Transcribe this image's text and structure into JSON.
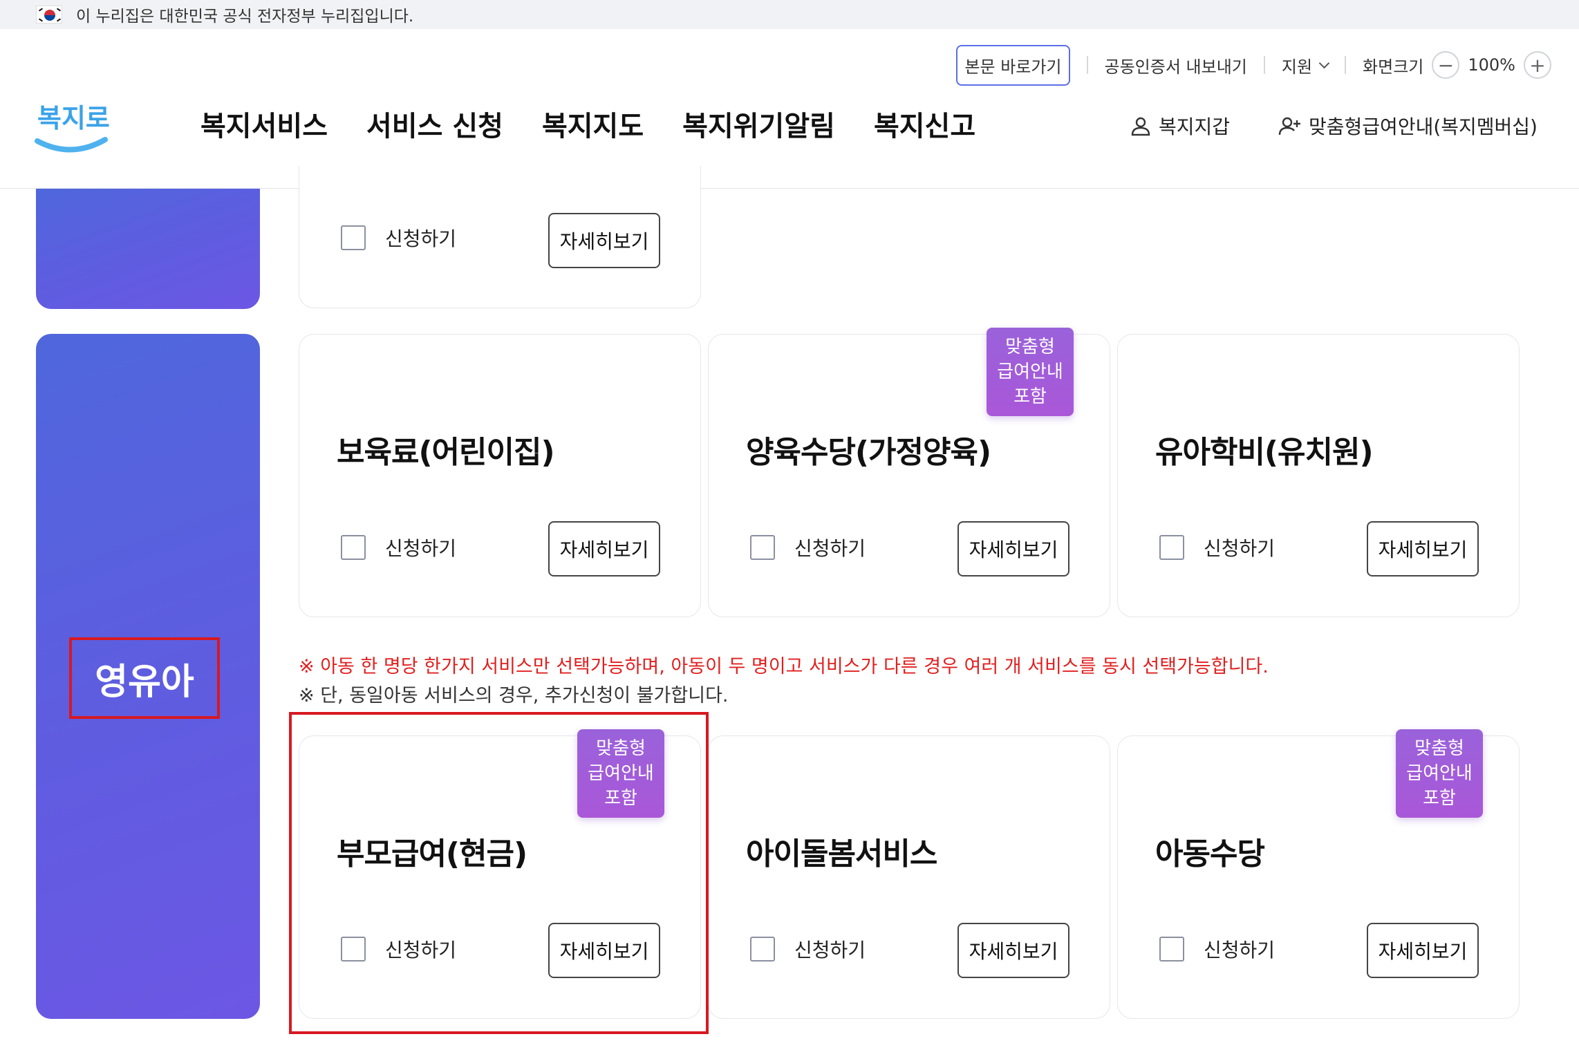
{
  "gov_banner": {
    "text": "이 누리집은 대한민국 공식 전자정부 누리집입니다.",
    "flag_icon": "korea-flag-icon"
  },
  "header": {
    "logo_text": "복지로",
    "util": {
      "skip_link": "본문 바로가기",
      "cert_export": "공동인증서 내보내기",
      "support": "지원",
      "screen_size": "화면크기",
      "zoom_minus": "−",
      "zoom_level": "100%",
      "zoom_plus": "+"
    },
    "gnb": [
      "복지서비스",
      "서비스 신청",
      "복지지도",
      "복지위기알림",
      "복지신고"
    ],
    "wallet": "복지지갑",
    "membership": "맞춤형급여안내(복지멤버십)"
  },
  "category": {
    "label": "영유아"
  },
  "common": {
    "apply_label": "신청하기",
    "detail_label": "자세히보기",
    "badge_line1": "맞춤형",
    "badge_line2": "급여안내",
    "badge_line3": "포함"
  },
  "cards_row1": [
    {
      "title": "보육료(어린이집)",
      "badge": false
    },
    {
      "title": "양육수당(가정양육)",
      "badge": true
    },
    {
      "title": "유아학비(유치원)",
      "badge": false
    }
  ],
  "notices": {
    "red": "※ 아동 한 명당 한가지 서비스만 선택가능하며, 아동이 두 명이고 서비스가 다른 경우 여러 개 서비스를 동시 선택가능합니다.",
    "dark": "※ 단, 동일아동 서비스의 경우, 추가신청이 불가합니다."
  },
  "cards_row2": [
    {
      "title": "부모급여(현금)",
      "badge": true
    },
    {
      "title": "아이돌봄서비스",
      "badge": false
    },
    {
      "title": "아동수당",
      "badge": true
    }
  ],
  "colors": {
    "accent": "#5e5de0",
    "badge": "#a05cd9",
    "notice_red": "#e0201f",
    "highlight": "#d71921"
  }
}
